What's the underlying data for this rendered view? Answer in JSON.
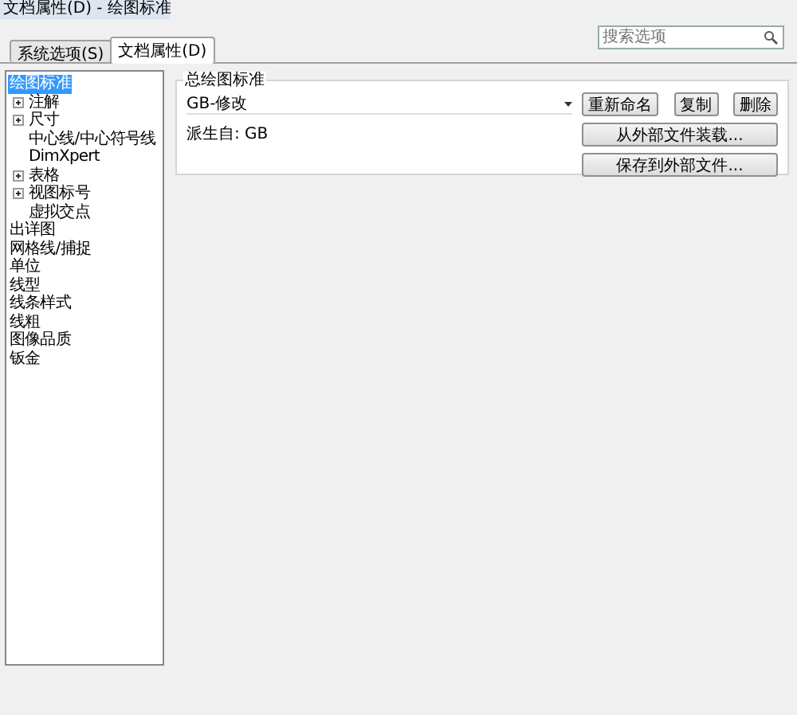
{
  "window": {
    "title": "文档属性(D) - 绘图标准"
  },
  "tabs": [
    {
      "label": "系统选项(S)",
      "selected": false
    },
    {
      "label": "文档属性(D)",
      "selected": true
    }
  ],
  "search": {
    "placeholder": "搜索选项"
  },
  "tree": [
    {
      "label": "绘图标准",
      "selected": true,
      "children": [
        {
          "label": "注解",
          "selected": false,
          "expanded": false
        },
        {
          "label": "尺寸",
          "selected": false,
          "expanded": false
        },
        {
          "label": "中心线/中心符号线",
          "selected": false
        },
        {
          "label": "DimXpert",
          "selected": false
        },
        {
          "label": "表格",
          "selected": false,
          "expanded": false
        },
        {
          "label": "视图标号",
          "selected": false,
          "expanded": false
        },
        {
          "label": "虚拟交点",
          "selected": false
        }
      ]
    },
    {
      "label": "出详图",
      "selected": false
    },
    {
      "label": "网格线/捕捉",
      "selected": false
    },
    {
      "label": "单位",
      "selected": false
    },
    {
      "label": "线型",
      "selected": false
    },
    {
      "label": "线条样式",
      "selected": false
    },
    {
      "label": "线粗",
      "selected": false
    },
    {
      "label": "图像品质",
      "selected": false
    },
    {
      "label": "钣金",
      "selected": false
    }
  ],
  "standard": {
    "label": "总绘图标准",
    "value": "GB-修改",
    "derived": "派生自: GB",
    "buttons": [
      "重新命名",
      "复制",
      "删除"
    ],
    "wide_buttons": [
      "从外部文件装载...",
      "保存到外部文件..."
    ]
  }
}
